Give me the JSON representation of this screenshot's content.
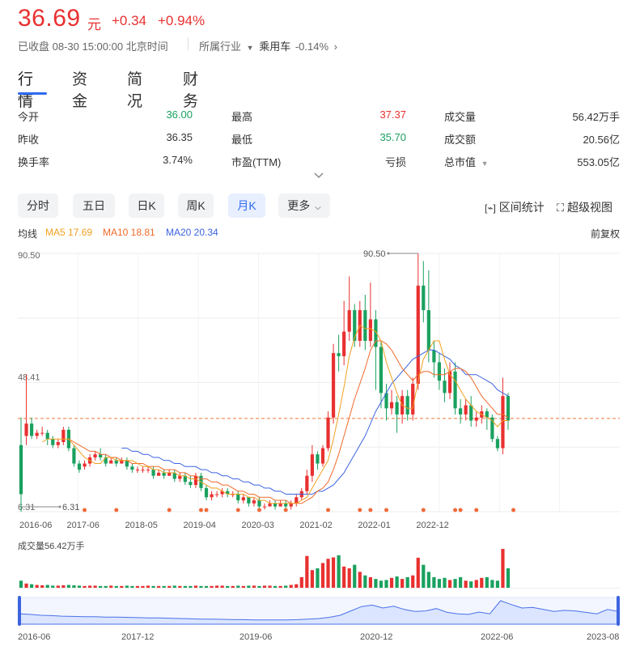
{
  "header": {
    "price": "36.69",
    "unit": "元",
    "change": "+0.34",
    "change_pct": "+0.94%",
    "status": "已收盘 08-30 15:00:00 北京时间",
    "industry_label": "所属行业",
    "industry_name": "乘用车",
    "industry_change": "-0.14%"
  },
  "tabs": [
    {
      "label": "行情",
      "active": true
    },
    {
      "label": "资金"
    },
    {
      "label": "简况"
    },
    {
      "label": "财务"
    }
  ],
  "quote": {
    "rows": [
      [
        {
          "label": "今开",
          "value": "36.00",
          "color": "green"
        },
        {
          "label": "最高",
          "value": "37.37",
          "color": "red"
        },
        {
          "label": "成交量",
          "value": "56.42万手"
        }
      ],
      [
        {
          "label": "昨收",
          "value": "36.35"
        },
        {
          "label": "最低",
          "value": "35.70",
          "color": "green"
        },
        {
          "label": "成交额",
          "value": "20.56亿"
        }
      ],
      [
        {
          "label": "换手率",
          "value": "3.74%"
        },
        {
          "label": "市盈(TTM)",
          "value": "亏损"
        },
        {
          "label": "总市值",
          "value": "553.05亿"
        }
      ]
    ]
  },
  "period_buttons": [
    {
      "label": "分时"
    },
    {
      "label": "五日"
    },
    {
      "label": "日K"
    },
    {
      "label": "周K"
    },
    {
      "label": "月K",
      "active": true
    },
    {
      "label": "更多"
    }
  ],
  "tools": {
    "range_stats": "区间统计",
    "super_view": "超级视图"
  },
  "ma_bar": {
    "title": "均线",
    "ma5": "MA5 17.69",
    "ma10": "MA10 18.81",
    "ma20": "MA20 20.34",
    "adjust": "前复权"
  },
  "colors": {
    "up": "#e93030",
    "down": "#1aa15f",
    "ma5": "#f0a020",
    "ma10": "#f06a2a",
    "ma20": "#3d64e0",
    "accent": "#2f6bf1"
  },
  "icons": {
    "range": "bracket-chart-icon",
    "super": "fullscreen-icon",
    "expand": "chevron-down-icon",
    "more": "chevron-down-icon"
  },
  "chart_data": {
    "type": "candlestick",
    "ylim": [
      6.31,
      90.5
    ],
    "y_ticks": [
      "90.50",
      "48.41",
      "6.31"
    ],
    "max_label": "90.50",
    "min_label": "6.31",
    "last_close_line": 36.69,
    "x_ticks": [
      "2016-06",
      "2017-06",
      "2018-05",
      "2019-04",
      "2020-03",
      "2021-02",
      "2022-01",
      "2022-12"
    ],
    "candles": [
      [
        28,
        12,
        37,
        6.31
      ],
      [
        31,
        35,
        51,
        28
      ],
      [
        35,
        31,
        37,
        30
      ],
      [
        31,
        32,
        33,
        30
      ],
      [
        32,
        32,
        34,
        31
      ],
      [
        32,
        30,
        33,
        28
      ],
      [
        30,
        28,
        31,
        27
      ],
      [
        28,
        29,
        30,
        27
      ],
      [
        29,
        33,
        34,
        28
      ],
      [
        33,
        27,
        34,
        26
      ],
      [
        27,
        22,
        28,
        21
      ],
      [
        22,
        20,
        23,
        19
      ],
      [
        21,
        22,
        23,
        20
      ],
      [
        22,
        24,
        25,
        21
      ],
      [
        24,
        25,
        26,
        23
      ],
      [
        25,
        24,
        27,
        23
      ],
      [
        24,
        22,
        25,
        21
      ],
      [
        22,
        23,
        24,
        22
      ],
      [
        23,
        22,
        24,
        21
      ],
      [
        22,
        23,
        24,
        22
      ],
      [
        23,
        21,
        24,
        20
      ],
      [
        21,
        20,
        22,
        19
      ],
      [
        20,
        20,
        21,
        19
      ],
      [
        20,
        20,
        21,
        19
      ],
      [
        20,
        20,
        21,
        19
      ],
      [
        20,
        18,
        21,
        17
      ],
      [
        18,
        19,
        20,
        18
      ],
      [
        19,
        18,
        20,
        17
      ],
      [
        18,
        19,
        20,
        18
      ],
      [
        19,
        17,
        20,
        16
      ],
      [
        17,
        18,
        19,
        16
      ],
      [
        18,
        16,
        19,
        15
      ],
      [
        16,
        15,
        18,
        14
      ],
      [
        15,
        18,
        19,
        14
      ],
      [
        18,
        14,
        19,
        13
      ],
      [
        14,
        11,
        15,
        10
      ],
      [
        11,
        12,
        13,
        10
      ],
      [
        12,
        12,
        13,
        11
      ],
      [
        12,
        13,
        14,
        11
      ],
      [
        13,
        12,
        14,
        11
      ],
      [
        12,
        12,
        13,
        11
      ],
      [
        12,
        10,
        13,
        9
      ],
      [
        10,
        11,
        12,
        9
      ],
      [
        11,
        9,
        11,
        8
      ],
      [
        9,
        10,
        11,
        8
      ],
      [
        10,
        8,
        11,
        7
      ],
      [
        8,
        8,
        9,
        7
      ],
      [
        8,
        9,
        10,
        8
      ],
      [
        9,
        8,
        10,
        7
      ],
      [
        8,
        9,
        10,
        8
      ],
      [
        9,
        8,
        10,
        7
      ],
      [
        8,
        9,
        10,
        7
      ],
      [
        9,
        11,
        12,
        8
      ],
      [
        11,
        13,
        14,
        10
      ],
      [
        13,
        18,
        20,
        12
      ],
      [
        18,
        25,
        28,
        16
      ],
      [
        25,
        22,
        26,
        20
      ],
      [
        22,
        27,
        28,
        21
      ],
      [
        27,
        37,
        39,
        26
      ],
      [
        37,
        58,
        61,
        35
      ],
      [
        58,
        57,
        64,
        52
      ],
      [
        57,
        65,
        75,
        54
      ],
      [
        65,
        72,
        83,
        62
      ],
      [
        72,
        62,
        74,
        60
      ],
      [
        62,
        72,
        75,
        60
      ],
      [
        72,
        62,
        77,
        59
      ],
      [
        62,
        69,
        81,
        60
      ],
      [
        69,
        60,
        72,
        46
      ],
      [
        60,
        45,
        62,
        40
      ],
      [
        45,
        40,
        48,
        36
      ],
      [
        40,
        42,
        46,
        38
      ],
      [
        42,
        38,
        44,
        32
      ],
      [
        38,
        44,
        46,
        35
      ],
      [
        44,
        38,
        46,
        36
      ],
      [
        38,
        48,
        50,
        36
      ],
      [
        48,
        80,
        90.5,
        46
      ],
      [
        80,
        72,
        88,
        68
      ],
      [
        72,
        59,
        85,
        55
      ],
      [
        59,
        55,
        62,
        50
      ],
      [
        55,
        49,
        58,
        46
      ],
      [
        49,
        45,
        53,
        42
      ],
      [
        45,
        52,
        55,
        43
      ],
      [
        52,
        40,
        55,
        38
      ],
      [
        40,
        38,
        43,
        35
      ],
      [
        38,
        41,
        43,
        36
      ],
      [
        41,
        36,
        44,
        34
      ],
      [
        36,
        37,
        39,
        34
      ],
      [
        37,
        39,
        41,
        35
      ],
      [
        39,
        37,
        40,
        33
      ],
      [
        37,
        30,
        38,
        29
      ],
      [
        30,
        27,
        31,
        26
      ],
      [
        27,
        44,
        50,
        25
      ],
      [
        44,
        36,
        45,
        33
      ]
    ],
    "ma5": [
      null,
      null,
      null,
      null,
      29,
      30,
      30,
      30,
      30,
      30,
      28,
      26,
      24,
      23,
      22,
      22,
      24,
      24,
      23,
      23,
      23,
      23,
      22,
      21,
      21,
      20,
      20,
      19,
      19,
      19,
      18,
      18,
      17,
      17,
      16,
      15,
      14,
      14,
      13,
      12,
      12,
      12,
      12,
      11,
      11,
      10,
      10,
      9,
      9,
      9,
      9,
      9,
      9,
      10,
      11,
      14,
      17,
      20,
      23,
      30,
      38,
      47,
      57,
      63,
      67,
      66,
      66,
      65,
      62,
      55,
      50,
      45,
      41,
      40,
      40,
      49,
      56,
      59,
      62,
      62,
      56,
      51,
      49,
      46,
      43,
      41,
      39,
      38,
      37,
      36,
      34,
      36,
      36
    ],
    "ma10": [
      null,
      null,
      null,
      null,
      null,
      null,
      null,
      null,
      null,
      30,
      29,
      28,
      27,
      26,
      26,
      25,
      25,
      24,
      24,
      23,
      23,
      22,
      22,
      22,
      21,
      21,
      21,
      20,
      20,
      20,
      19,
      19,
      18,
      18,
      17,
      17,
      16,
      16,
      15,
      15,
      14,
      13,
      13,
      12,
      12,
      11,
      11,
      11,
      10,
      10,
      10,
      9,
      9,
      9,
      10,
      11,
      13,
      14,
      16,
      20,
      25,
      31,
      37,
      43,
      48,
      53,
      59,
      62,
      62,
      61,
      59,
      56,
      53,
      51,
      49,
      51,
      52,
      52,
      51,
      51,
      51,
      52,
      53,
      53,
      52,
      50,
      47,
      44,
      42,
      40,
      38,
      38,
      37
    ],
    "ma20": [
      null,
      null,
      null,
      null,
      null,
      null,
      null,
      null,
      null,
      null,
      null,
      null,
      null,
      null,
      null,
      null,
      null,
      null,
      null,
      27,
      27,
      26,
      26,
      25,
      25,
      24,
      24,
      23,
      23,
      22,
      22,
      21,
      21,
      21,
      20,
      20,
      19,
      19,
      18,
      18,
      17,
      17,
      16,
      16,
      15,
      15,
      14,
      14,
      13,
      13,
      12,
      12,
      12,
      12,
      12,
      12,
      13,
      13,
      14,
      15,
      17,
      19,
      22,
      25,
      28,
      31,
      35,
      39,
      42,
      45,
      48,
      50,
      52,
      54,
      56,
      57,
      58,
      59,
      59,
      58,
      57,
      56,
      54,
      53,
      51,
      51,
      51,
      50,
      49,
      48,
      46,
      45,
      44
    ],
    "markers_idx": [
      12,
      18,
      28,
      34,
      35,
      41,
      45,
      50,
      58,
      64,
      66,
      69,
      76,
      82,
      83,
      86,
      93
    ],
    "volume": [
      20,
      12,
      10,
      8,
      7,
      8,
      6,
      6,
      7,
      8,
      7,
      6,
      5,
      6,
      6,
      5,
      5,
      6,
      5,
      5,
      6,
      5,
      5,
      5,
      6,
      5,
      5,
      5,
      5,
      6,
      5,
      5,
      5,
      6,
      5,
      5,
      5,
      6,
      6,
      5,
      5,
      6,
      5,
      6,
      6,
      5,
      6,
      6,
      5,
      5,
      6,
      8,
      10,
      30,
      90,
      50,
      55,
      70,
      82,
      86,
      92,
      60,
      55,
      65,
      45,
      35,
      30,
      25,
      20,
      22,
      28,
      32,
      25,
      30,
      35,
      85,
      65,
      45,
      30,
      25,
      28,
      22,
      25,
      30,
      20,
      18,
      22,
      28,
      30,
      22,
      20,
      110,
      55
    ],
    "volume_label": "成交量56.42万手",
    "overview": {
      "x_ticks": [
        "2016-06",
        "2017-12",
        "2019-06",
        "2020-12",
        "2022-06",
        "2023-08"
      ],
      "values": [
        30,
        28,
        25,
        24,
        22,
        21,
        20,
        20,
        19,
        19,
        18,
        17,
        16,
        16,
        15,
        14,
        13,
        12,
        12,
        11,
        10,
        10,
        9,
        9,
        9,
        9,
        10,
        12,
        14,
        18,
        25,
        40,
        55,
        60,
        50,
        56,
        45,
        38,
        40,
        48,
        35,
        30,
        28,
        36,
        30,
        75,
        62,
        50,
        52,
        45,
        38,
        42,
        40,
        35,
        30,
        45,
        38
      ]
    }
  }
}
